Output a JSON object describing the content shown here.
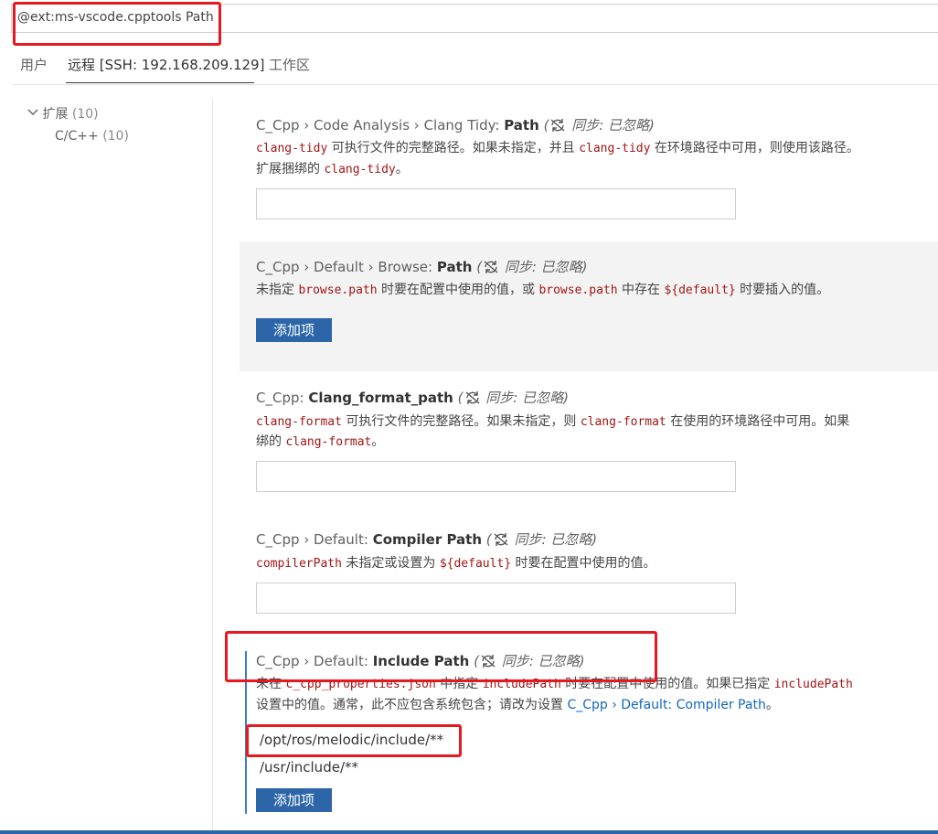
{
  "search": {
    "value": "@ext:ms-vscode.cpptools Path"
  },
  "tabs": [
    {
      "label": "用户"
    },
    {
      "label": "远程 [SSH: 192.168.209.129]"
    },
    {
      "label": "工作区"
    }
  ],
  "sidebar": {
    "items": [
      {
        "label": "扩展",
        "count": "(10)"
      },
      {
        "label": "C/C++",
        "count": "(10)"
      }
    ]
  },
  "settings": [
    {
      "cat1": "C_Cpp",
      "sep1": " › ",
      "cat2": "Code Analysis",
      "sep2": " › ",
      "cat3": "Clang Tidy: ",
      "key": "Path",
      "sync": "同步: 已忽略",
      "desc_line1": {
        "code1": "clang-tidy",
        "t1": " 可执行文件的完整路径。如果未指定，并且 ",
        "code2": "clang-tidy",
        "t2": " 在环境路径中可用，则使用该路径。"
      },
      "desc_line2": {
        "t1": "扩展捆绑的 ",
        "code1": "clang-tidy",
        "t2": "。"
      },
      "value": ""
    },
    {
      "cat1": "C_Cpp",
      "sep1": " › ",
      "cat2": "Default",
      "sep2": " › ",
      "cat3": "Browse: ",
      "key": "Path",
      "sync": "同步: 已忽略",
      "desc_line1": {
        "t1": "未指定 ",
        "code1": "browse.path",
        "t2": " 时要在配置中使用的值，或 ",
        "code2": "browse.path",
        "t3": " 中存在 ",
        "code3": "${default}",
        "t4": " 时要插入的值。"
      },
      "add_button": "添加项"
    },
    {
      "cat1": "C_Cpp: ",
      "key": "Clang_format_path",
      "sync": "同步: 已忽略",
      "desc_line1": {
        "code1": "clang-format",
        "t1": " 可执行文件的完整路径。如果未指定，则 ",
        "code2": "clang-format",
        "t2": " 在使用的环境路径中可用。如果"
      },
      "desc_line2": {
        "t1": "绑的 ",
        "code1": "clang-format",
        "t2": "。"
      },
      "value": ""
    },
    {
      "cat1": "C_Cpp",
      "sep1": " › ",
      "cat2": "Default: ",
      "key": "Compiler Path",
      "sync": "同步: 已忽略",
      "desc_line1": {
        "code1": "compilerPath",
        "t1": " 未指定或设置为 ",
        "code2": "${default}",
        "t2": " 时要在配置中使用的值。"
      },
      "value": ""
    },
    {
      "cat1": "C_Cpp",
      "sep1": " › ",
      "cat2": "Default: ",
      "key": "Include Path",
      "sync": "同步: 已忽略",
      "desc_line1": {
        "t1": "未在 ",
        "code1": "c_cpp_properties.json",
        "t2": " 中指定 ",
        "code2": "includePath",
        "t3": " 时要在配置中使用的值。如果已指定 ",
        "code3": "includePath"
      },
      "desc_line2": {
        "t1": "设置中的值。通常，此不应包含系统包含；请改为设置 ",
        "link": "C_Cpp › Default: Compiler Path",
        "t2": "。"
      },
      "items": [
        "/opt/ros/melodic/include/**",
        "/usr/include/**"
      ],
      "add_button": "添加项"
    }
  ],
  "colors": {
    "accent": "#2c66a8",
    "highlight": "#e5191f",
    "code": "#a31515",
    "link": "#1067c0"
  },
  "icons": {
    "sync": "sync-ignored-icon",
    "chevron": "chevron-down-icon"
  }
}
